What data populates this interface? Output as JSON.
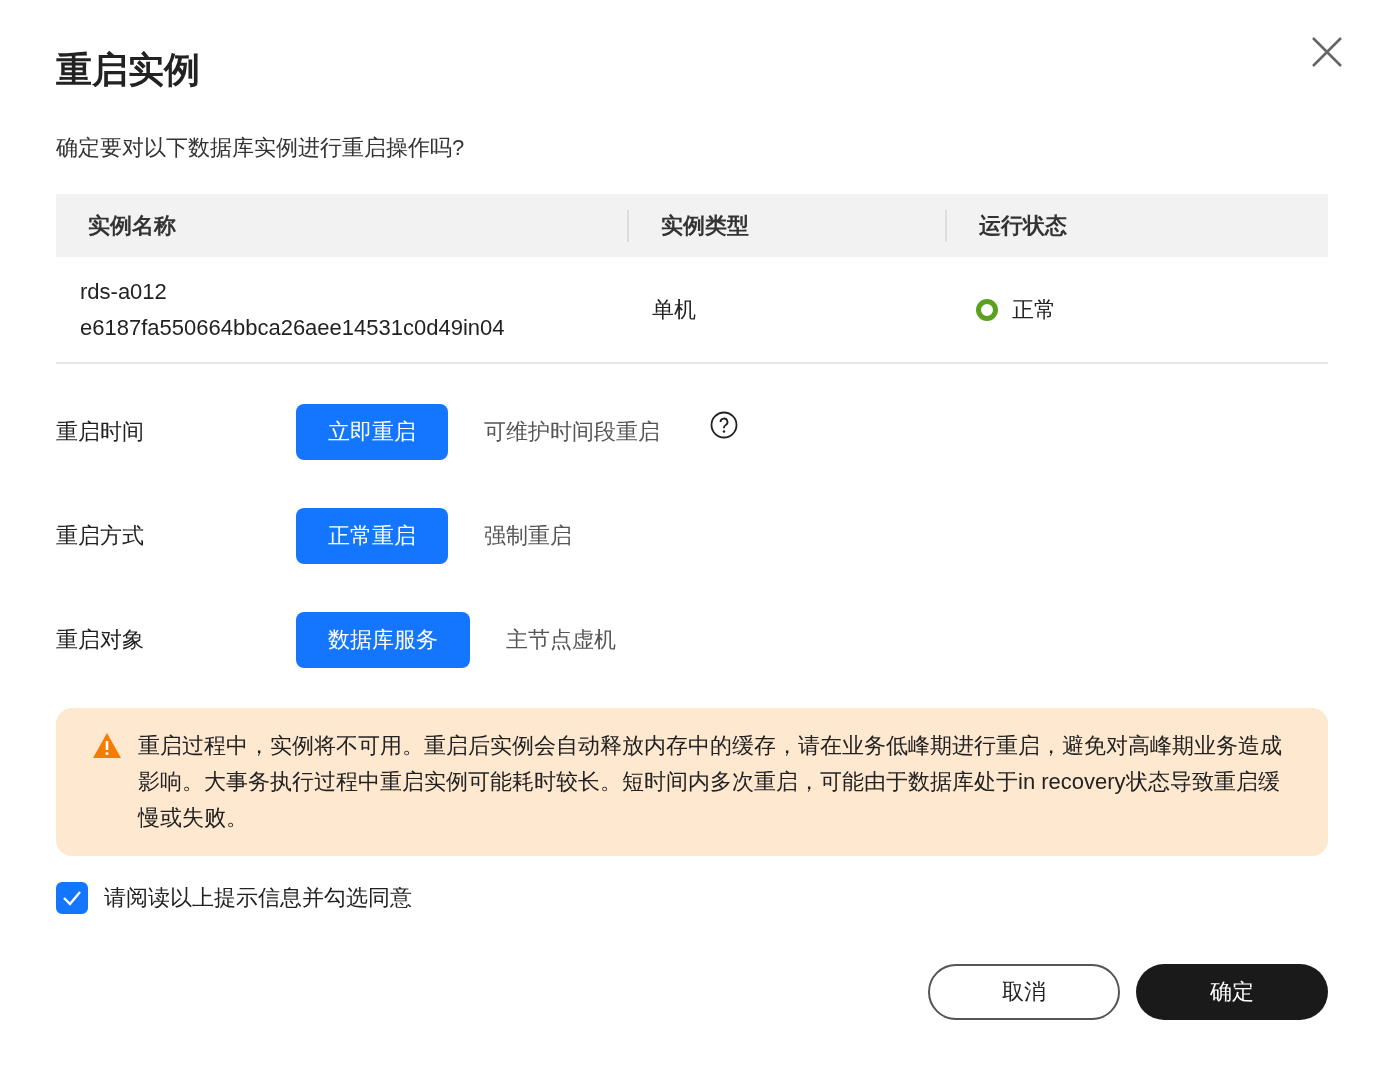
{
  "dialog": {
    "title": "重启实例",
    "prompt": "确定要对以下数据库实例进行重启操作吗?"
  },
  "table": {
    "columns": [
      "实例名称",
      "实例类型",
      "运行状态"
    ],
    "rows": [
      {
        "name": "rds-a012 e6187fa550664bbca26aee14531c0d49in04",
        "type": "单机",
        "status": "正常",
        "color": "#5aa11e"
      }
    ]
  },
  "options": [
    {
      "label": "重启时间",
      "help": true,
      "choices": [
        {
          "label": "立即重启",
          "selected": true
        },
        {
          "label": "可维护时间段重启",
          "selected": false
        }
      ]
    },
    {
      "label": "重启方式",
      "help": false,
      "choices": [
        {
          "label": "正常重启",
          "selected": true
        },
        {
          "label": "强制重启",
          "selected": false
        }
      ]
    },
    {
      "label": "重启对象",
      "help": false,
      "choices": [
        {
          "label": "数据库服务",
          "selected": true
        },
        {
          "label": "主节点虚机",
          "selected": false
        }
      ]
    }
  ],
  "warning": {
    "text": "重启过程中，实例将不可用。重启后实例会自动释放内存中的缓存，请在业务低峰期进行重启，避免对高峰期业务造成影响。大事务执行过程中重启实例可能耗时较长。短时间内多次重启，可能由于数据库处于in recovery状态导致重启缓慢或失败。"
  },
  "agreement": {
    "label": "请阅读以上提示信息并勾选同意",
    "checked": true
  },
  "buttons": [
    {
      "label": "取消",
      "kind": "secondary"
    },
    {
      "label": "确定",
      "kind": "primary"
    }
  ]
}
